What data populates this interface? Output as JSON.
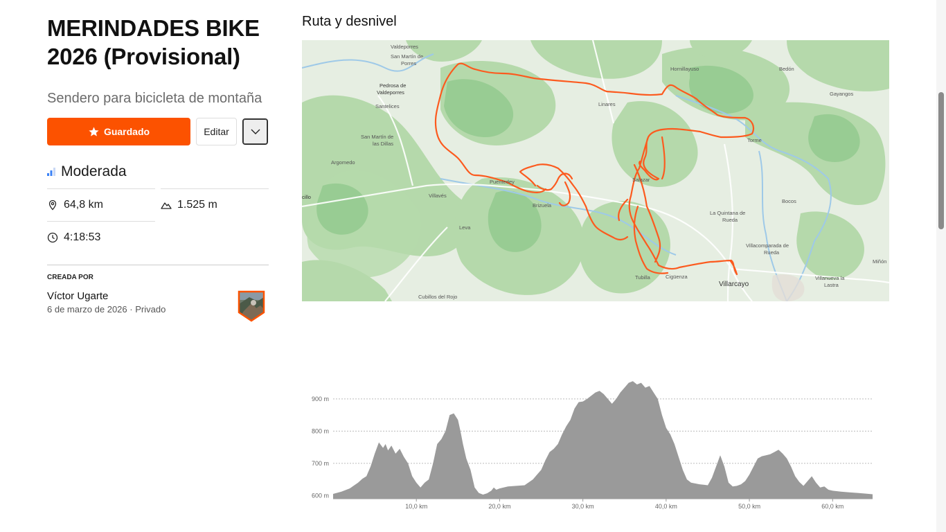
{
  "route": {
    "title_line1": "MERINDADES BIKE",
    "title_line2": "2026 (Provisional)",
    "type": "Sendero para bicicleta de montaña",
    "difficulty": "Moderada",
    "distance": "64,8 km",
    "elevation_gain": "1.525 m",
    "time": "4:18:53"
  },
  "actions": {
    "saved_label": "Guardado",
    "edit_label": "Editar"
  },
  "creator": {
    "label": "CREADA POR",
    "name": "Víctor Ugarte",
    "date": "6 de marzo de 2026",
    "privacy": "Privado"
  },
  "section_title": "Ruta y desnivel",
  "map_labels": {
    "valdeporres": "Valdeporres",
    "san_martin_porres": "San Martín de",
    "porres": "Porres",
    "pedrosa": "Pedrosa de",
    "valdeporres2": "Valdeporres",
    "santelices": "Santelices",
    "san_martin_dillas": "San Martín de",
    "las_dillas": "las Dillas",
    "argomedo": "Argomedo",
    "villaves": "Villavés",
    "leva": "Leva",
    "cillo": "cillo",
    "puentedey": "Puentedey",
    "brizuela": "Brizuela",
    "linares": "Linares",
    "hornillayuso": "Hornillayuso",
    "bedon": "Bedón",
    "gayangos": "Gayangos",
    "torme": "Torme",
    "salazar": "Salazar",
    "quintana": "La Quintana de",
    "rueda": "Rueda",
    "bocos": "Bocos",
    "villacomparada": "Villacomparada de",
    "rueda2": "Rueda",
    "minon": "Miñón",
    "villanueva": "Villanueva la",
    "lastra": "Lastra",
    "tubilla": "Tubilla",
    "cigüenza": "Cigüenza",
    "villarcayo": "Villarcayo",
    "cubillos": "Cubillos del Rojo"
  },
  "colors": {
    "accent": "#fc5200",
    "route_line": "#fc5a1e",
    "elevation_fill": "#9a9a9a",
    "map_green": "#b9dbb0",
    "map_dark_green": "#8ccc8a"
  },
  "chart_data": {
    "type": "area",
    "title": "",
    "xlabel": "",
    "ylabel": "",
    "xlim": [
      0,
      64.8
    ],
    "ylim": [
      590,
      960
    ],
    "y_ticks": [
      900,
      800,
      700,
      600
    ],
    "y_tick_labels": [
      "900 m",
      "800 m",
      "700 m",
      "600 m"
    ],
    "x_ticks": [
      10,
      20,
      30,
      40,
      50,
      60
    ],
    "x_tick_labels": [
      "10,0 km",
      "20,0 km",
      "30,0 km",
      "40,0 km",
      "50,0 km",
      "60,0 km"
    ],
    "grid": true,
    "series": [
      {
        "x": [
          0,
          1,
          2,
          3,
          3.5,
          4,
          4.5,
          5,
          5.5,
          6,
          6.3,
          6.6,
          7,
          7.5,
          8,
          8.5,
          9,
          9.5,
          10,
          10.5,
          11,
          11.5,
          12,
          12.5,
          13,
          13.5,
          14,
          14.5,
          15,
          15.3,
          15.6,
          16,
          16.5,
          17,
          17.5,
          18,
          18.5,
          19,
          19.3,
          19.6,
          20,
          21,
          22,
          23,
          24,
          24.5,
          25,
          25.5,
          26,
          26.5,
          27,
          27.5,
          28,
          28.5,
          29,
          29.5,
          30,
          30.5,
          31,
          31.5,
          32,
          32.5,
          33,
          33.5,
          34,
          34.5,
          35,
          35.5,
          36,
          36.5,
          37,
          37.5,
          38,
          38.5,
          39,
          39.5,
          40,
          40.5,
          41,
          41.5,
          42,
          42.5,
          43,
          44,
          45,
          45.5,
          46,
          46.5,
          47,
          47.5,
          48,
          48.5,
          49,
          49.5,
          50,
          50.5,
          51,
          51.5,
          52,
          52.5,
          53,
          53.5,
          54,
          54.5,
          55,
          55.5,
          56,
          56.5,
          57,
          57.5,
          58,
          58.5,
          59,
          59.5,
          60,
          61,
          62,
          63,
          64,
          64.8
        ],
        "y": [
          605,
          612,
          622,
          640,
          652,
          660,
          690,
          730,
          765,
          748,
          760,
          740,
          755,
          730,
          745,
          720,
          700,
          660,
          640,
          625,
          640,
          650,
          700,
          760,
          775,
          800,
          850,
          855,
          835,
          800,
          760,
          715,
          680,
          625,
          608,
          603,
          607,
          615,
          625,
          618,
          622,
          628,
          630,
          632,
          650,
          665,
          680,
          710,
          735,
          745,
          760,
          790,
          815,
          835,
          870,
          890,
          892,
          900,
          910,
          920,
          925,
          915,
          900,
          885,
          900,
          920,
          935,
          950,
          955,
          945,
          950,
          935,
          940,
          920,
          900,
          850,
          810,
          790,
          760,
          720,
          680,
          650,
          640,
          635,
          632,
          655,
          690,
          725,
          690,
          640,
          628,
          630,
          635,
          645,
          665,
          690,
          715,
          722,
          725,
          728,
          735,
          742,
          730,
          715,
          690,
          660,
          642,
          630,
          645,
          660,
          640,
          625,
          628,
          618,
          615,
          612,
          610,
          608,
          606,
          604
        ]
      }
    ]
  }
}
